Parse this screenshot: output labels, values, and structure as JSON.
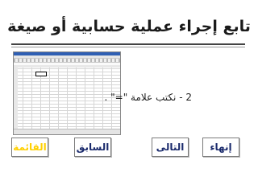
{
  "slide": {
    "title": "تابع إجراء عملية حسابية أو صيغة",
    "instruction": "2 - نكتب علامة \"=\" ."
  },
  "buttons": {
    "finish": "إنهاء",
    "next": "التالى",
    "previous": "السابق",
    "menu": "القائمة"
  },
  "colors": {
    "button_text": "#1a2a6c",
    "menu_text": "#ffd000",
    "spreadsheet_titlebar": "#2f5fb3"
  }
}
